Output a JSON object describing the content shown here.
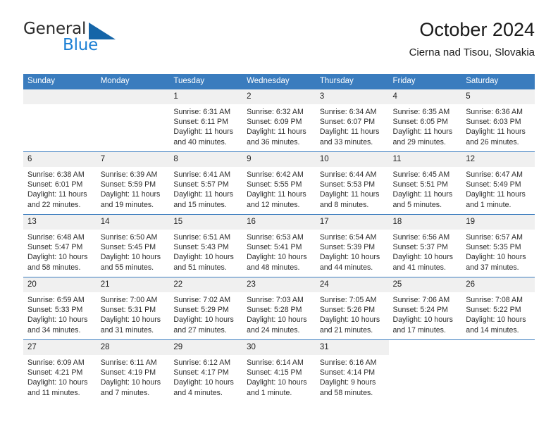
{
  "brand": {
    "name_part1": "General",
    "name_part2": "Blue",
    "mark": "triangle-logo-icon",
    "color_dark": "#2b2b2b",
    "color_blue": "#1b7fd4"
  },
  "header": {
    "title": "October 2024",
    "subtitle": "Cierna nad Tisou, Slovakia"
  },
  "theme": {
    "header_band": "#3a7cbe",
    "day_header_bg": "#f0f0f0",
    "cell_bg": "#ffffff",
    "text": "#2c2c2c"
  },
  "weekday_headers": [
    "Sunday",
    "Monday",
    "Tuesday",
    "Wednesday",
    "Thursday",
    "Friday",
    "Saturday"
  ],
  "weeks": [
    [
      {
        "day": "",
        "sunrise": "",
        "sunset": "",
        "daylight": "",
        "state": "empty"
      },
      {
        "day": "",
        "sunrise": "",
        "sunset": "",
        "daylight": "",
        "state": "empty"
      },
      {
        "day": "1",
        "sunrise": "Sunrise: 6:31 AM",
        "sunset": "Sunset: 6:11 PM",
        "daylight": "Daylight: 11 hours and 40 minutes.",
        "state": "filled"
      },
      {
        "day": "2",
        "sunrise": "Sunrise: 6:32 AM",
        "sunset": "Sunset: 6:09 PM",
        "daylight": "Daylight: 11 hours and 36 minutes.",
        "state": "filled"
      },
      {
        "day": "3",
        "sunrise": "Sunrise: 6:34 AM",
        "sunset": "Sunset: 6:07 PM",
        "daylight": "Daylight: 11 hours and 33 minutes.",
        "state": "filled"
      },
      {
        "day": "4",
        "sunrise": "Sunrise: 6:35 AM",
        "sunset": "Sunset: 6:05 PM",
        "daylight": "Daylight: 11 hours and 29 minutes.",
        "state": "filled"
      },
      {
        "day": "5",
        "sunrise": "Sunrise: 6:36 AM",
        "sunset": "Sunset: 6:03 PM",
        "daylight": "Daylight: 11 hours and 26 minutes.",
        "state": "filled"
      }
    ],
    [
      {
        "day": "6",
        "sunrise": "Sunrise: 6:38 AM",
        "sunset": "Sunset: 6:01 PM",
        "daylight": "Daylight: 11 hours and 22 minutes.",
        "state": "filled"
      },
      {
        "day": "7",
        "sunrise": "Sunrise: 6:39 AM",
        "sunset": "Sunset: 5:59 PM",
        "daylight": "Daylight: 11 hours and 19 minutes.",
        "state": "filled"
      },
      {
        "day": "8",
        "sunrise": "Sunrise: 6:41 AM",
        "sunset": "Sunset: 5:57 PM",
        "daylight": "Daylight: 11 hours and 15 minutes.",
        "state": "filled"
      },
      {
        "day": "9",
        "sunrise": "Sunrise: 6:42 AM",
        "sunset": "Sunset: 5:55 PM",
        "daylight": "Daylight: 11 hours and 12 minutes.",
        "state": "filled"
      },
      {
        "day": "10",
        "sunrise": "Sunrise: 6:44 AM",
        "sunset": "Sunset: 5:53 PM",
        "daylight": "Daylight: 11 hours and 8 minutes.",
        "state": "filled"
      },
      {
        "day": "11",
        "sunrise": "Sunrise: 6:45 AM",
        "sunset": "Sunset: 5:51 PM",
        "daylight": "Daylight: 11 hours and 5 minutes.",
        "state": "filled"
      },
      {
        "day": "12",
        "sunrise": "Sunrise: 6:47 AM",
        "sunset": "Sunset: 5:49 PM",
        "daylight": "Daylight: 11 hours and 1 minute.",
        "state": "filled"
      }
    ],
    [
      {
        "day": "13",
        "sunrise": "Sunrise: 6:48 AM",
        "sunset": "Sunset: 5:47 PM",
        "daylight": "Daylight: 10 hours and 58 minutes.",
        "state": "filled"
      },
      {
        "day": "14",
        "sunrise": "Sunrise: 6:50 AM",
        "sunset": "Sunset: 5:45 PM",
        "daylight": "Daylight: 10 hours and 55 minutes.",
        "state": "filled"
      },
      {
        "day": "15",
        "sunrise": "Sunrise: 6:51 AM",
        "sunset": "Sunset: 5:43 PM",
        "daylight": "Daylight: 10 hours and 51 minutes.",
        "state": "filled"
      },
      {
        "day": "16",
        "sunrise": "Sunrise: 6:53 AM",
        "sunset": "Sunset: 5:41 PM",
        "daylight": "Daylight: 10 hours and 48 minutes.",
        "state": "filled"
      },
      {
        "day": "17",
        "sunrise": "Sunrise: 6:54 AM",
        "sunset": "Sunset: 5:39 PM",
        "daylight": "Daylight: 10 hours and 44 minutes.",
        "state": "filled"
      },
      {
        "day": "18",
        "sunrise": "Sunrise: 6:56 AM",
        "sunset": "Sunset: 5:37 PM",
        "daylight": "Daylight: 10 hours and 41 minutes.",
        "state": "filled"
      },
      {
        "day": "19",
        "sunrise": "Sunrise: 6:57 AM",
        "sunset": "Sunset: 5:35 PM",
        "daylight": "Daylight: 10 hours and 37 minutes.",
        "state": "filled"
      }
    ],
    [
      {
        "day": "20",
        "sunrise": "Sunrise: 6:59 AM",
        "sunset": "Sunset: 5:33 PM",
        "daylight": "Daylight: 10 hours and 34 minutes.",
        "state": "filled"
      },
      {
        "day": "21",
        "sunrise": "Sunrise: 7:00 AM",
        "sunset": "Sunset: 5:31 PM",
        "daylight": "Daylight: 10 hours and 31 minutes.",
        "state": "filled"
      },
      {
        "day": "22",
        "sunrise": "Sunrise: 7:02 AM",
        "sunset": "Sunset: 5:29 PM",
        "daylight": "Daylight: 10 hours and 27 minutes.",
        "state": "filled"
      },
      {
        "day": "23",
        "sunrise": "Sunrise: 7:03 AM",
        "sunset": "Sunset: 5:28 PM",
        "daylight": "Daylight: 10 hours and 24 minutes.",
        "state": "filled"
      },
      {
        "day": "24",
        "sunrise": "Sunrise: 7:05 AM",
        "sunset": "Sunset: 5:26 PM",
        "daylight": "Daylight: 10 hours and 21 minutes.",
        "state": "filled"
      },
      {
        "day": "25",
        "sunrise": "Sunrise: 7:06 AM",
        "sunset": "Sunset: 5:24 PM",
        "daylight": "Daylight: 10 hours and 17 minutes.",
        "state": "filled"
      },
      {
        "day": "26",
        "sunrise": "Sunrise: 7:08 AM",
        "sunset": "Sunset: 5:22 PM",
        "daylight": "Daylight: 10 hours and 14 minutes.",
        "state": "filled"
      }
    ],
    [
      {
        "day": "27",
        "sunrise": "Sunrise: 6:09 AM",
        "sunset": "Sunset: 4:21 PM",
        "daylight": "Daylight: 10 hours and 11 minutes.",
        "state": "filled"
      },
      {
        "day": "28",
        "sunrise": "Sunrise: 6:11 AM",
        "sunset": "Sunset: 4:19 PM",
        "daylight": "Daylight: 10 hours and 7 minutes.",
        "state": "filled"
      },
      {
        "day": "29",
        "sunrise": "Sunrise: 6:12 AM",
        "sunset": "Sunset: 4:17 PM",
        "daylight": "Daylight: 10 hours and 4 minutes.",
        "state": "filled"
      },
      {
        "day": "30",
        "sunrise": "Sunrise: 6:14 AM",
        "sunset": "Sunset: 4:15 PM",
        "daylight": "Daylight: 10 hours and 1 minute.",
        "state": "filled"
      },
      {
        "day": "31",
        "sunrise": "Sunrise: 6:16 AM",
        "sunset": "Sunset: 4:14 PM",
        "daylight": "Daylight: 9 hours and 58 minutes.",
        "state": "filled"
      },
      {
        "day": "",
        "sunrise": "",
        "sunset": "",
        "daylight": "",
        "state": "blank"
      },
      {
        "day": "",
        "sunrise": "",
        "sunset": "",
        "daylight": "",
        "state": "blank"
      }
    ]
  ]
}
